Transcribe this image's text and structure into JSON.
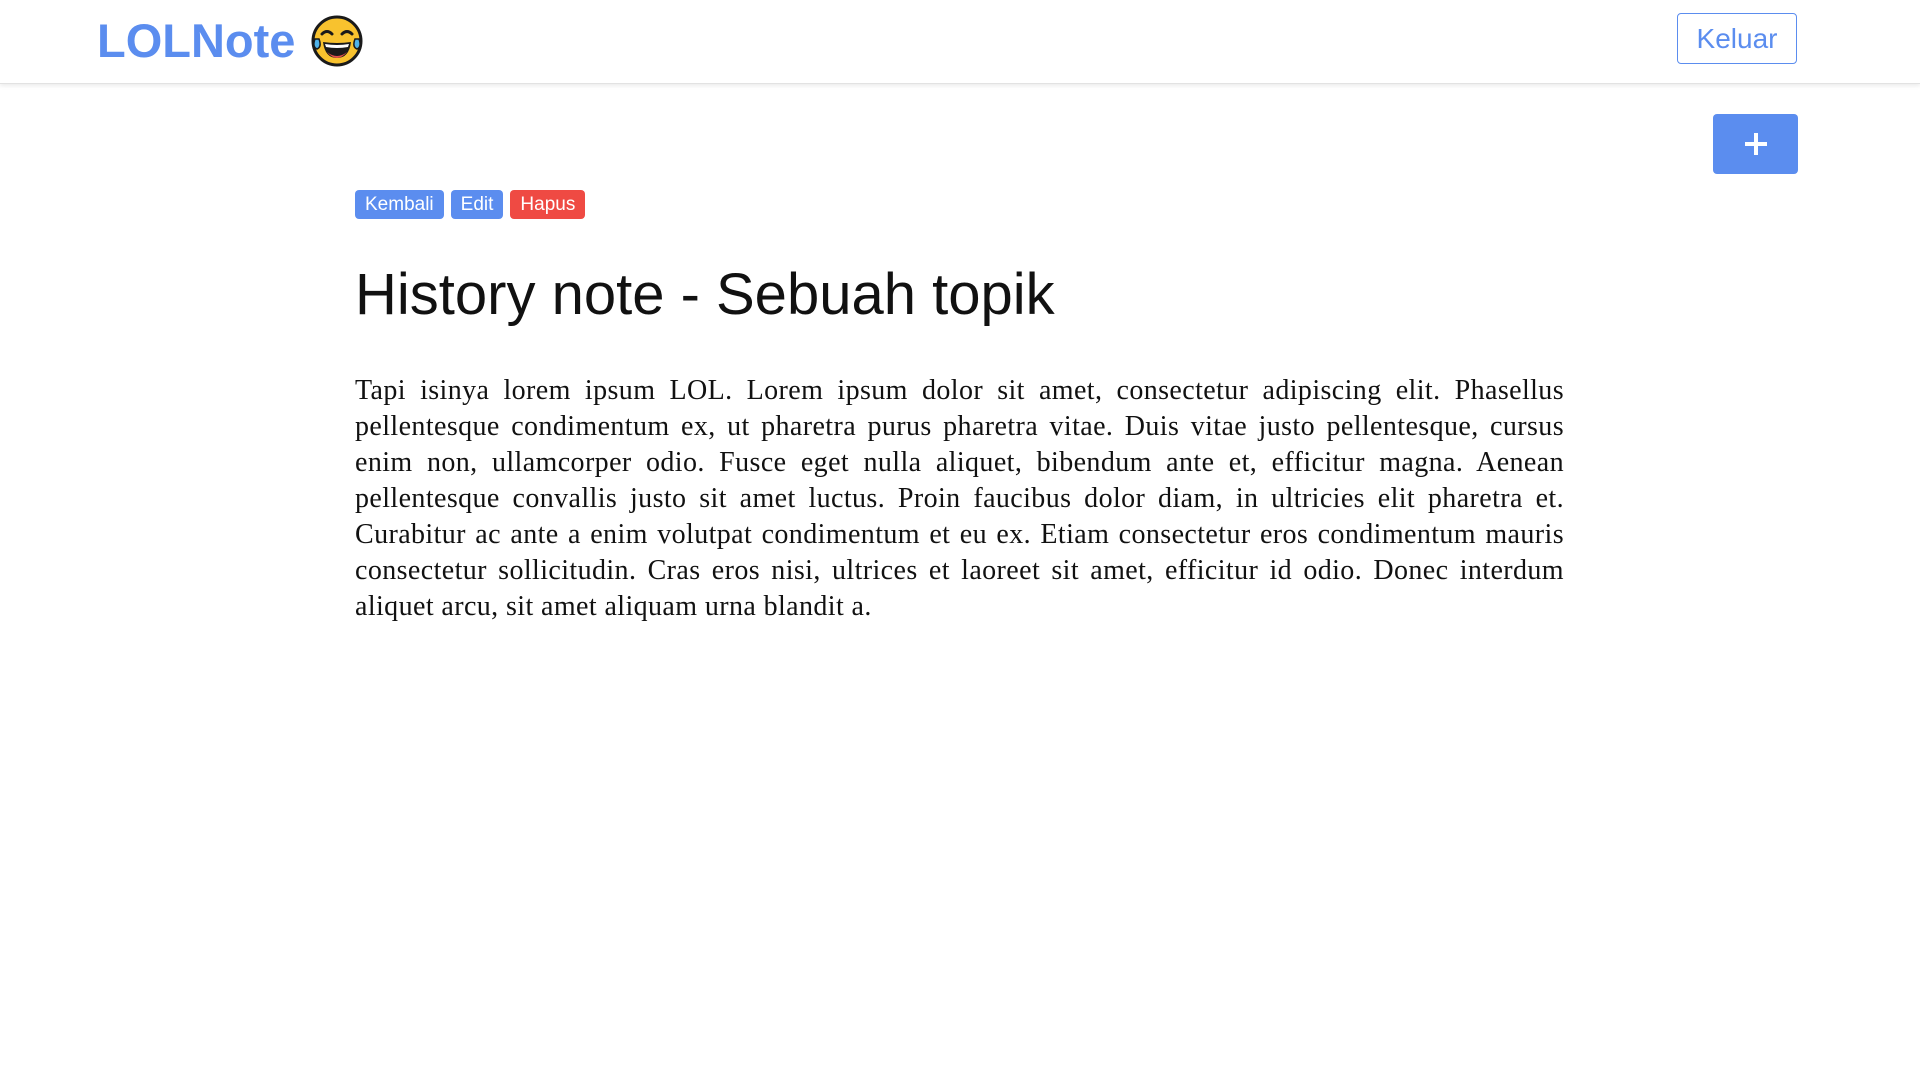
{
  "navbar": {
    "brand": "LOLNote",
    "brand_icon": "face-with-tears-of-joy-icon",
    "logout_label": "Keluar",
    "accent_color": "#5b8def"
  },
  "fab": {
    "icon": "plus-icon"
  },
  "actions": {
    "back_label": "Kembali",
    "edit_label": "Edit",
    "delete_label": "Hapus",
    "danger_color": "#ef4a43"
  },
  "note": {
    "title": "History note - Sebuah topik",
    "body": "Tapi isinya lorem ipsum LOL. Lorem ipsum dolor sit amet, consectetur adipiscing elit. Phasellus pellentesque condimentum ex, ut pharetra purus pharetra vitae. Duis vitae justo pellentesque, cursus enim non, ullamcorper odio. Fusce eget nulla aliquet, bibendum ante et, efficitur magna. Aenean pellentesque convallis justo sit amet luctus. Proin faucibus dolor diam, in ultricies elit pharetra et. Curabitur ac ante a enim volutpat condimentum et eu ex. Etiam consectetur eros condimentum mauris consectetur sollicitudin. Cras eros nisi, ultrices et laoreet sit amet, efficitur id odio. Donec interdum aliquet arcu, sit amet aliquam urna blandit a."
  }
}
